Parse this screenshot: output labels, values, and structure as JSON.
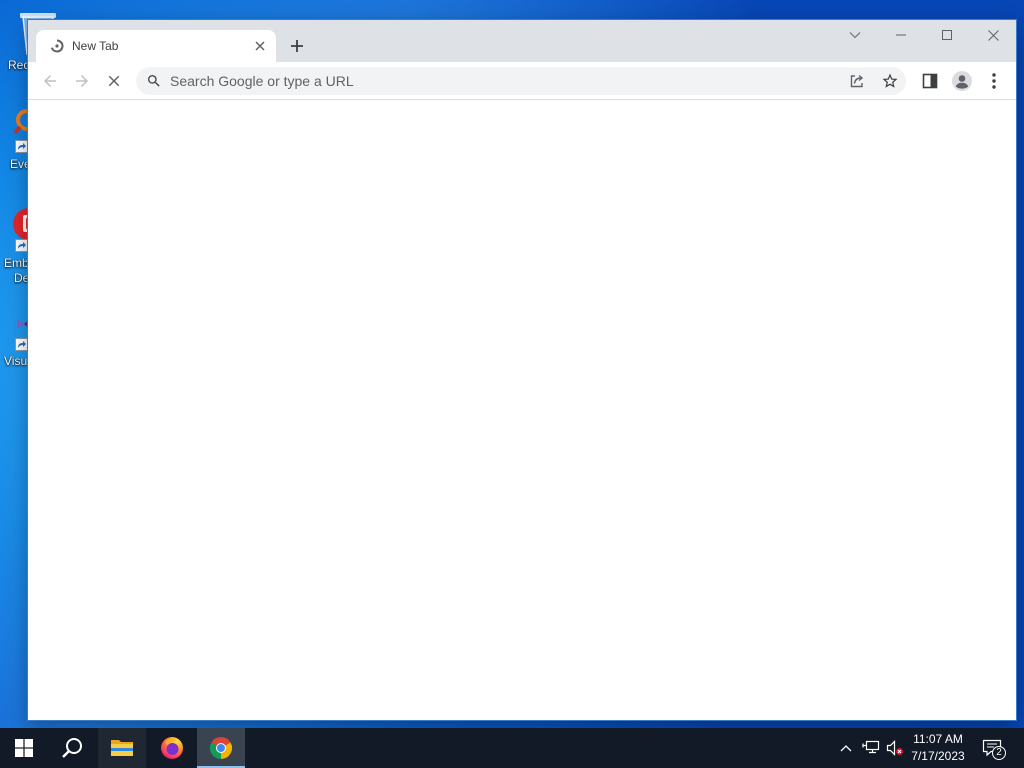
{
  "desktop": {
    "icons": [
      {
        "label": "Rec",
        "icon": "recycle-bin-icon"
      },
      {
        "label": "Eve",
        "icon": "orange-app-icon",
        "overlay": "shortcut-arrow-icon"
      },
      {
        "label": "Emb",
        "label_line2": "De",
        "icon": "red-app-icon",
        "overlay": "shortcut-arrow-icon"
      },
      {
        "label": "Visu",
        "icon": "visual-studio-icon",
        "overlay": "shortcut-arrow-icon"
      }
    ]
  },
  "browser": {
    "tabs": [
      {
        "title": "New Tab",
        "favicon": "loading-spinner-icon",
        "active": true,
        "close_icon": "close-icon"
      }
    ],
    "new_tab_icon": "plus-icon",
    "window_controls": {
      "tab_search": "chevron-down-icon",
      "minimize": "minimize-icon",
      "maximize": "maximize-icon",
      "close": "close-icon"
    },
    "toolbar": {
      "back": {
        "icon": "arrow-left-icon",
        "enabled": false
      },
      "forward": {
        "icon": "arrow-right-icon",
        "enabled": false
      },
      "stop": {
        "icon": "stop-loading-icon",
        "enabled": true
      },
      "side_panel": {
        "icon": "side-panel-icon"
      },
      "profile": {
        "icon": "profile-icon"
      },
      "menu": {
        "icon": "kebab-menu-icon"
      }
    },
    "omnibox": {
      "value": "",
      "placeholder": "Search Google or type a URL",
      "search_icon": "search-icon",
      "share_icon": "share-icon",
      "bookmark_icon": "star-outline-icon"
    },
    "page": {
      "loading": true
    }
  },
  "taskbar": {
    "start_icon": "windows-logo-icon",
    "search_icon": "search-icon",
    "apps": [
      {
        "icon": "file-explorer-icon",
        "active": false
      },
      {
        "icon": "firefox-icon",
        "active": false
      },
      {
        "icon": "chrome-icon",
        "active": true
      }
    ],
    "tray": {
      "show_hidden_icon": "chevron-up-icon",
      "network_icon": "network-wired-icon",
      "volume_icon": "volume-muted-icon",
      "clock": {
        "time": "11:07 AM",
        "date": "7/17/2023"
      },
      "notifications": {
        "icon": "action-center-icon",
        "count": "2"
      }
    }
  },
  "colors": {
    "tabstrip_bg": "#dee1e6",
    "omnibox_bg": "#f1f3f4",
    "toolbar_icon": "#5f6368",
    "disabled_icon": "#bdc1c6",
    "taskbar_bg": "#111a26",
    "taskbar_active_bg": "#3a4450",
    "desktop_blue": "#0e84e4"
  }
}
